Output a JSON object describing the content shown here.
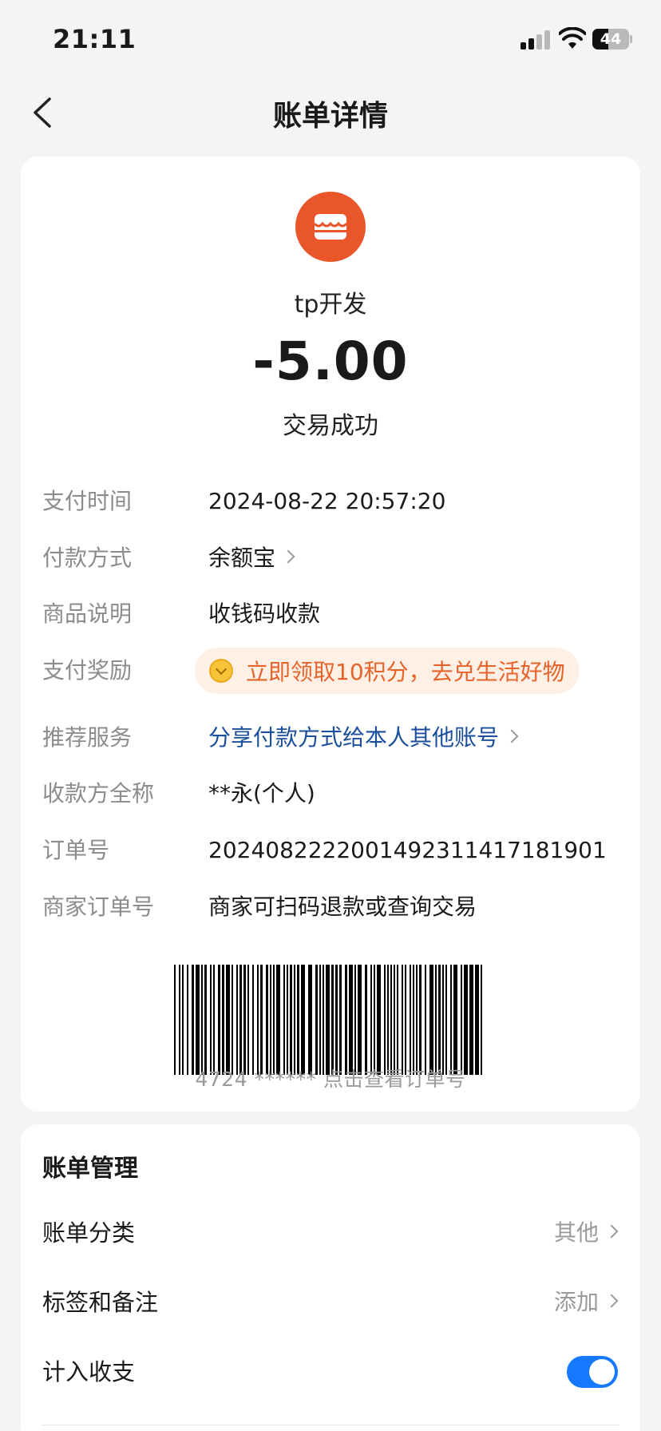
{
  "status_bar": {
    "time": "21:11",
    "battery": "44",
    "battery_level": 0.44
  },
  "nav": {
    "title": "账单详情",
    "back_icon": "chevron-left-icon"
  },
  "summary": {
    "merchant_icon": "store-icon",
    "merchant_name": "tp开发",
    "amount": "-5.00",
    "status": "交易成功",
    "brand_color": "#e8562a"
  },
  "details": {
    "pay_time": {
      "label": "支付时间",
      "value": "2024-08-22 20:57:20"
    },
    "pay_method": {
      "label": "付款方式",
      "value": "余额宝"
    },
    "description": {
      "label": "商品说明",
      "value": "收钱码收款"
    },
    "reward": {
      "label": "支付奖励",
      "value": "立即领取10积分，去兑生活好物"
    },
    "service": {
      "label": "推荐服务",
      "value": "分享付款方式给本人其他账号"
    },
    "payee": {
      "label": "收款方全称",
      "value": "**永(个人)"
    },
    "order_no": {
      "label": "订单号",
      "value": "2024082222001492311417181901"
    },
    "merchant_order": {
      "label": "商家订单号",
      "value": "商家可扫码退款或查询交易"
    }
  },
  "barcode": {
    "caption": "4724 ****** 点击查看订单号"
  },
  "manage": {
    "title": "账单管理",
    "category": {
      "label": "账单分类",
      "value": "其他"
    },
    "tags": {
      "label": "标签和备注",
      "value": "添加"
    },
    "include": {
      "label": "计入收支",
      "enabled": true
    }
  }
}
